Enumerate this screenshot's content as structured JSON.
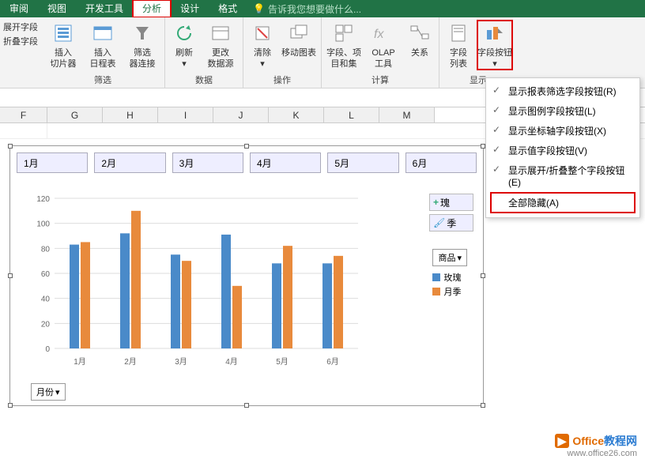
{
  "tabs": {
    "items": [
      "审阅",
      "视图",
      "开发工具",
      "分析",
      "设计",
      "格式"
    ],
    "active_index": 3,
    "tellme": "告诉我您想要做什么..."
  },
  "side_small": {
    "expand": "展开字段",
    "collapse": "折叠字段"
  },
  "ribbon": {
    "filter": {
      "slicer": "插入\n切片器",
      "timeline": "插入\n日程表",
      "conn": "筛选\n器连接",
      "label": "筛选"
    },
    "data": {
      "refresh": "刷新",
      "change": "更改\n数据源",
      "label": "数据"
    },
    "ops": {
      "clear": "清除",
      "move": "移动图表",
      "label": "操作"
    },
    "calc": {
      "fields": "字段、项\n目和集",
      "olap": "OLAP\n工具",
      "rel": "关系",
      "label": "计算"
    },
    "show": {
      "list": "字段\n列表",
      "btns": "字段按钮",
      "label": "显示"
    }
  },
  "columns": [
    "F",
    "G",
    "H",
    "I",
    "J",
    "K",
    "L",
    "M"
  ],
  "months": [
    "1月",
    "2月",
    "3月",
    "4月",
    "5月",
    "6月"
  ],
  "chart_data": {
    "type": "bar",
    "title": "",
    "xlabel": "",
    "ylabel": "",
    "ylim": [
      0,
      120
    ],
    "yticks": [
      0,
      20,
      40,
      60,
      80,
      100,
      120
    ],
    "categories": [
      "1月",
      "2月",
      "3月",
      "4月",
      "5月",
      "6月"
    ],
    "series": [
      {
        "name": "玫瑰",
        "color": "#4a8ac9",
        "values": [
          83,
          92,
          75,
          91,
          68,
          68
        ]
      },
      {
        "name": "月季",
        "color": "#e88a3c",
        "values": [
          85,
          110,
          70,
          50,
          82,
          74
        ]
      }
    ],
    "legend_title": "商品",
    "xfilter_label": "月份"
  },
  "side_chart_btns": {
    "add": "瑰",
    "style": "季"
  },
  "dropdown": {
    "items": [
      {
        "label": "显示报表筛选字段按钮(R)",
        "checked": true
      },
      {
        "label": "显示图例字段按钮(L)",
        "checked": true
      },
      {
        "label": "显示坐标轴字段按钮(X)",
        "checked": true
      },
      {
        "label": "显示值字段按钮(V)",
        "checked": true
      },
      {
        "label": "显示展开/折叠整个字段按钮(E)",
        "checked": true
      },
      {
        "label": "全部隐藏(A)",
        "checked": false,
        "highlight": true
      }
    ]
  },
  "footer": {
    "t1": "Office",
    "t2": "教程网",
    "url": "www.office26.com"
  }
}
